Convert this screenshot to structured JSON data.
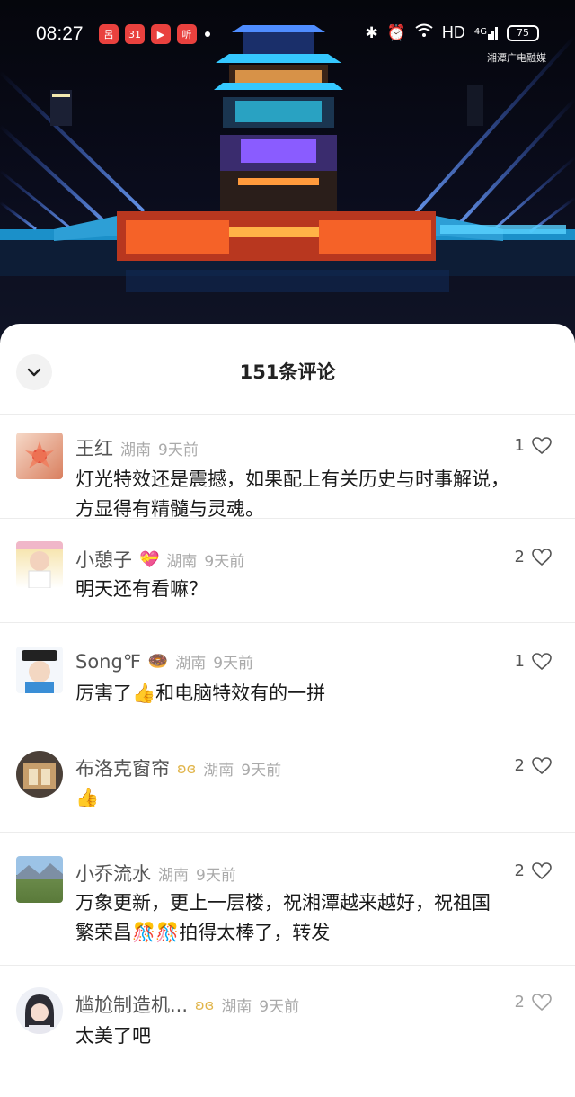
{
  "status_bar": {
    "time": "08:27",
    "app_icons": [
      "呂",
      "31",
      "▶",
      "听"
    ],
    "network": "HD",
    "signal": "4G",
    "battery": "75"
  },
  "watermark": "湘潭广电融媒",
  "sheet": {
    "title": "151条评论"
  },
  "comments": [
    {
      "name": "王红",
      "location": "湖南",
      "time": "9天前",
      "likes": "1",
      "text_lines": [
        "灯光特效还是震撼，如果配上有关历史与时事解说，",
        "方显得有精髓与灵魂。"
      ]
    },
    {
      "name": "小憩子",
      "name_emoji": "💝",
      "location": "湖南",
      "time": "9天前",
      "likes": "2",
      "text_lines": [
        "明天还有看嘛？"
      ]
    },
    {
      "name": "Song℉",
      "name_emoji": "🍩",
      "location": "湖南",
      "time": "9天前",
      "likes": "1",
      "text_lines": [
        "厉害了👍和电脑特效有的一拼"
      ]
    },
    {
      "name": "布洛克窗帘",
      "location": "湖南",
      "time": "9天前",
      "likes": "2",
      "text_lines": [
        "👍"
      ]
    },
    {
      "name": "小乔流水",
      "location": "湖南",
      "time": "9天前",
      "likes": "2",
      "text_lines": [
        "万象更新，更上一层楼，祝湘潭越来越好，祝祖国",
        "繁荣昌🎊🎊拍得太棒了，转发"
      ]
    },
    {
      "name": "尴尬制造机...",
      "location": "湖南",
      "time": "9天前",
      "likes": "2",
      "text_lines": [
        "太美了吧"
      ]
    }
  ],
  "colors": {
    "accent_red": "#e9413e",
    "badge_gold": "#e1b54b",
    "light_cyan": "#1fb6ff",
    "light_orange": "#ff6a2a"
  }
}
